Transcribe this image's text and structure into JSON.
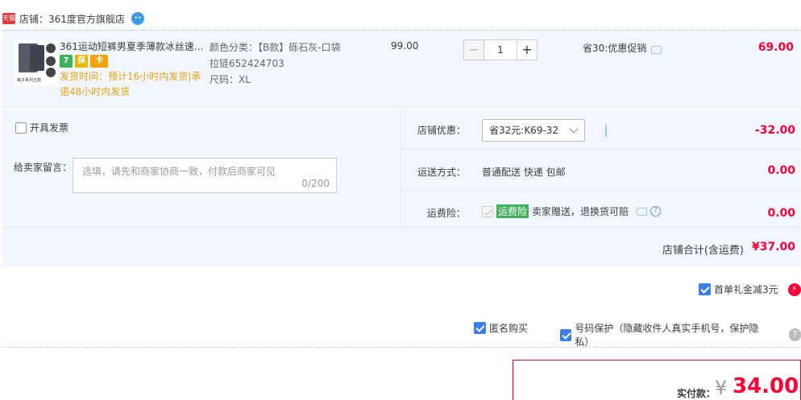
{
  "store": {
    "badge": "天猫",
    "label": "店铺：361度官方旗舰店",
    "chat_icon": "wangwang-icon"
  },
  "item": {
    "thumb_caption": "株子系列五款",
    "title": "361运动短裤男夏季薄款冰丝速...",
    "badges": [
      "7",
      "保",
      "卡"
    ],
    "ship_time": "发货时间：预计16小时内发货|承诺48小时内发货",
    "sku_lines": [
      "颜色分类：【B款】砾石灰-口袋",
      "拉链652424703",
      "尺码：XL"
    ],
    "unit_price": "99.00",
    "qty_minus": "−",
    "qty_value": "1",
    "qty_plus": "+",
    "promo": "省30:优惠促销",
    "total": "69.00"
  },
  "options": {
    "invoice_label": "开具发票",
    "message_label": "给卖家留言：",
    "message_placeholder": "选填，请先和商家协商一致，付款后商家可见",
    "message_count": "0/200",
    "store_discount_label": "店铺优惠：",
    "store_discount_value": "省32元:K69-32",
    "store_discount_amount": "-32.00",
    "shipping_label": "运送方式：",
    "shipping_value": "普通配送 快递 包邮",
    "shipping_amount": "0.00",
    "insurance_label": "运费险：",
    "insurance_tag": "运费险",
    "insurance_desc": "卖家赠送，退换货可赔",
    "insurance_amount": "0.00",
    "subtotal_label": "店铺合计(含运费)",
    "subtotal_amount": "¥37.00"
  },
  "bottom": {
    "gift_label": "首单礼金减3元",
    "anonymous_label": "匿名购买",
    "phone_protect_label": "号码保护（隐藏收件人真实手机号，保护隐私）",
    "pay_label": "实付款：",
    "pay_currency": "¥",
    "pay_amount": "34.00"
  },
  "colors": {
    "accent_red": "#ff0036",
    "panel_bg": "#f2f7ff",
    "check_blue": "#3d7fea",
    "ship_orange": "#f0a30a"
  }
}
